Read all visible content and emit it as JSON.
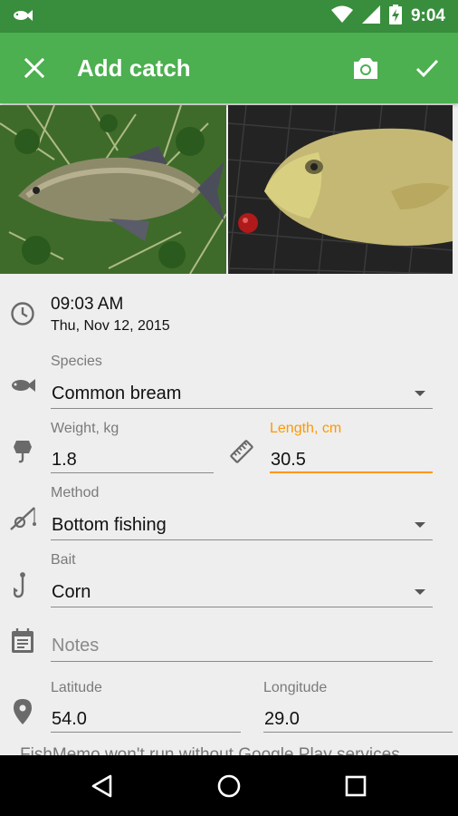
{
  "status_bar": {
    "time": "9:04"
  },
  "toolbar": {
    "title": "Add catch"
  },
  "datetime": {
    "time": "09:03 AM",
    "date": "Thu, Nov 12, 2015"
  },
  "species": {
    "label": "Species",
    "value": "Common bream"
  },
  "weight": {
    "label": "Weight, kg",
    "value": "1.8"
  },
  "length": {
    "label": "Length, cm",
    "value": "30.5"
  },
  "method": {
    "label": "Method",
    "value": "Bottom fishing"
  },
  "bait": {
    "label": "Bait",
    "value": "Corn"
  },
  "notes": {
    "placeholder": "Notes"
  },
  "latitude": {
    "label": "Latitude",
    "value": "54.0"
  },
  "longitude": {
    "label": "Longitude",
    "value": "29.0"
  },
  "notice": "FishMemo won't run without Google Play services",
  "colors": {
    "status_bar": "#388e3c",
    "toolbar": "#4caf50",
    "accent": "#ff9800",
    "background": "#eeeeee"
  },
  "icons": [
    "fish-notification-icon",
    "wifi-icon",
    "signal-icon",
    "battery-icon",
    "close-icon",
    "camera-icon",
    "check-icon",
    "clock-icon",
    "fish-icon",
    "weight-icon",
    "ruler-icon",
    "fishing-rod-icon",
    "hook-icon",
    "notes-icon",
    "location-pin-icon",
    "back-icon",
    "home-icon",
    "recents-icon"
  ]
}
